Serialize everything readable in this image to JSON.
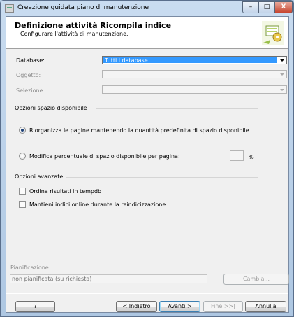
{
  "window": {
    "title": "Creazione guidata piano di manutenzione",
    "controls": {
      "minimize": "–",
      "maximize": "□",
      "close": "X"
    }
  },
  "header": {
    "title": "Definizione attività Ricompila indice",
    "subtitle": "Configurare l'attività di manutenzione.",
    "icon": "maintenance-wizard-icon"
  },
  "fields": {
    "database_label": "Database:",
    "database_value": "Tutti i database",
    "object_label": "Oggetto:",
    "object_value": "",
    "selection_label": "Selezione:",
    "selection_value": ""
  },
  "free_space": {
    "group_label": "Opzioni spazio disponibile",
    "option_reorganize": "Riorganizza le pagine mantenendo la quantità predefinita di spazio disponibile",
    "option_reorganize_selected": true,
    "option_percent": "Modifica percentuale di spazio disponibile per pagina:",
    "percent_value": "",
    "percent_unit": "%"
  },
  "advanced": {
    "group_label": "Opzioni avanzate",
    "sort_tempdb": "Ordina risultati in tempdb",
    "sort_tempdb_checked": false,
    "online_indexes": "Mantieni indici online durante la reindicizzazione",
    "online_indexes_checked": false
  },
  "schedule": {
    "label": "Pianificazione:",
    "value": "non pianificata (su richiesta)",
    "change_button": "Cambia..."
  },
  "footer": {
    "help_button": "?",
    "back_button": "< Indietro",
    "next_button": "Avanti >",
    "finish_button": "Fine >>|",
    "cancel_button": "Annulla"
  },
  "colors": {
    "selection_highlight": "#3399ff",
    "radio_dot": "#1c3f76"
  }
}
